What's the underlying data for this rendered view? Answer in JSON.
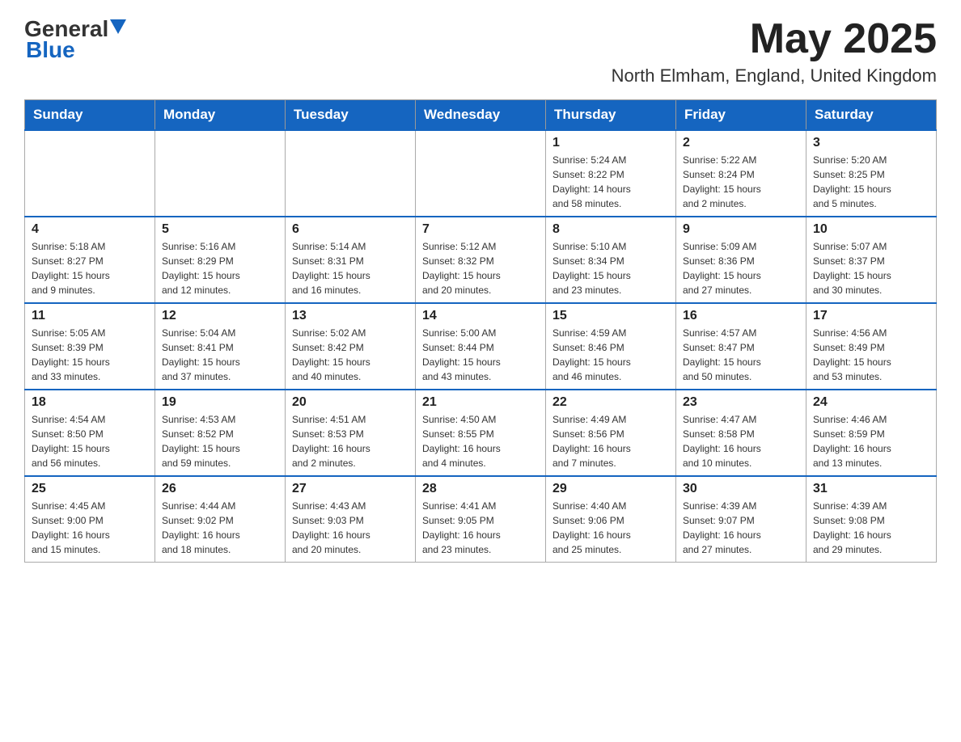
{
  "header": {
    "logo_general": "General",
    "logo_blue": "Blue",
    "month_title": "May 2025",
    "location": "North Elmham, England, United Kingdom"
  },
  "days_of_week": [
    "Sunday",
    "Monday",
    "Tuesday",
    "Wednesday",
    "Thursday",
    "Friday",
    "Saturday"
  ],
  "weeks": [
    [
      {
        "day": "",
        "info": ""
      },
      {
        "day": "",
        "info": ""
      },
      {
        "day": "",
        "info": ""
      },
      {
        "day": "",
        "info": ""
      },
      {
        "day": "1",
        "info": "Sunrise: 5:24 AM\nSunset: 8:22 PM\nDaylight: 14 hours\nand 58 minutes."
      },
      {
        "day": "2",
        "info": "Sunrise: 5:22 AM\nSunset: 8:24 PM\nDaylight: 15 hours\nand 2 minutes."
      },
      {
        "day": "3",
        "info": "Sunrise: 5:20 AM\nSunset: 8:25 PM\nDaylight: 15 hours\nand 5 minutes."
      }
    ],
    [
      {
        "day": "4",
        "info": "Sunrise: 5:18 AM\nSunset: 8:27 PM\nDaylight: 15 hours\nand 9 minutes."
      },
      {
        "day": "5",
        "info": "Sunrise: 5:16 AM\nSunset: 8:29 PM\nDaylight: 15 hours\nand 12 minutes."
      },
      {
        "day": "6",
        "info": "Sunrise: 5:14 AM\nSunset: 8:31 PM\nDaylight: 15 hours\nand 16 minutes."
      },
      {
        "day": "7",
        "info": "Sunrise: 5:12 AM\nSunset: 8:32 PM\nDaylight: 15 hours\nand 20 minutes."
      },
      {
        "day": "8",
        "info": "Sunrise: 5:10 AM\nSunset: 8:34 PM\nDaylight: 15 hours\nand 23 minutes."
      },
      {
        "day": "9",
        "info": "Sunrise: 5:09 AM\nSunset: 8:36 PM\nDaylight: 15 hours\nand 27 minutes."
      },
      {
        "day": "10",
        "info": "Sunrise: 5:07 AM\nSunset: 8:37 PM\nDaylight: 15 hours\nand 30 minutes."
      }
    ],
    [
      {
        "day": "11",
        "info": "Sunrise: 5:05 AM\nSunset: 8:39 PM\nDaylight: 15 hours\nand 33 minutes."
      },
      {
        "day": "12",
        "info": "Sunrise: 5:04 AM\nSunset: 8:41 PM\nDaylight: 15 hours\nand 37 minutes."
      },
      {
        "day": "13",
        "info": "Sunrise: 5:02 AM\nSunset: 8:42 PM\nDaylight: 15 hours\nand 40 minutes."
      },
      {
        "day": "14",
        "info": "Sunrise: 5:00 AM\nSunset: 8:44 PM\nDaylight: 15 hours\nand 43 minutes."
      },
      {
        "day": "15",
        "info": "Sunrise: 4:59 AM\nSunset: 8:46 PM\nDaylight: 15 hours\nand 46 minutes."
      },
      {
        "day": "16",
        "info": "Sunrise: 4:57 AM\nSunset: 8:47 PM\nDaylight: 15 hours\nand 50 minutes."
      },
      {
        "day": "17",
        "info": "Sunrise: 4:56 AM\nSunset: 8:49 PM\nDaylight: 15 hours\nand 53 minutes."
      }
    ],
    [
      {
        "day": "18",
        "info": "Sunrise: 4:54 AM\nSunset: 8:50 PM\nDaylight: 15 hours\nand 56 minutes."
      },
      {
        "day": "19",
        "info": "Sunrise: 4:53 AM\nSunset: 8:52 PM\nDaylight: 15 hours\nand 59 minutes."
      },
      {
        "day": "20",
        "info": "Sunrise: 4:51 AM\nSunset: 8:53 PM\nDaylight: 16 hours\nand 2 minutes."
      },
      {
        "day": "21",
        "info": "Sunrise: 4:50 AM\nSunset: 8:55 PM\nDaylight: 16 hours\nand 4 minutes."
      },
      {
        "day": "22",
        "info": "Sunrise: 4:49 AM\nSunset: 8:56 PM\nDaylight: 16 hours\nand 7 minutes."
      },
      {
        "day": "23",
        "info": "Sunrise: 4:47 AM\nSunset: 8:58 PM\nDaylight: 16 hours\nand 10 minutes."
      },
      {
        "day": "24",
        "info": "Sunrise: 4:46 AM\nSunset: 8:59 PM\nDaylight: 16 hours\nand 13 minutes."
      }
    ],
    [
      {
        "day": "25",
        "info": "Sunrise: 4:45 AM\nSunset: 9:00 PM\nDaylight: 16 hours\nand 15 minutes."
      },
      {
        "day": "26",
        "info": "Sunrise: 4:44 AM\nSunset: 9:02 PM\nDaylight: 16 hours\nand 18 minutes."
      },
      {
        "day": "27",
        "info": "Sunrise: 4:43 AM\nSunset: 9:03 PM\nDaylight: 16 hours\nand 20 minutes."
      },
      {
        "day": "28",
        "info": "Sunrise: 4:41 AM\nSunset: 9:05 PM\nDaylight: 16 hours\nand 23 minutes."
      },
      {
        "day": "29",
        "info": "Sunrise: 4:40 AM\nSunset: 9:06 PM\nDaylight: 16 hours\nand 25 minutes."
      },
      {
        "day": "30",
        "info": "Sunrise: 4:39 AM\nSunset: 9:07 PM\nDaylight: 16 hours\nand 27 minutes."
      },
      {
        "day": "31",
        "info": "Sunrise: 4:39 AM\nSunset: 9:08 PM\nDaylight: 16 hours\nand 29 minutes."
      }
    ]
  ]
}
